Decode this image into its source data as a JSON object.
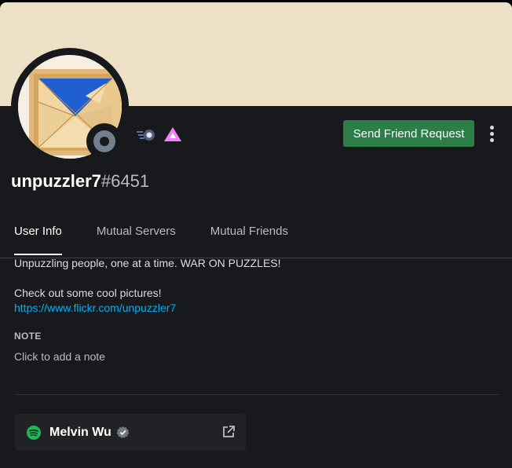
{
  "profile": {
    "username": "unpuzzler7",
    "discriminator": "#6451",
    "status": "offline",
    "banner_color": "#ede0c7",
    "badges": [
      "hypesquad-balance-icon",
      "early-supporter-icon"
    ]
  },
  "actions": {
    "friend_request_label": "Send Friend Request",
    "friend_request_color": "#2d7d46"
  },
  "tabs": [
    {
      "label": "User Info",
      "active": true
    },
    {
      "label": "Mutual Servers",
      "active": false
    },
    {
      "label": "Mutual Friends",
      "active": false
    }
  ],
  "user_info": {
    "bio_line1": "Unpuzzling people, one at a time. WAR ON PUZZLES!",
    "bio_line2": "Check out some cool pictures!",
    "bio_link": "https://www.flickr.com/unpuzzler7",
    "note_title": "NOTE",
    "note_placeholder": "Click to add a note"
  },
  "connections": [
    {
      "service": "spotify",
      "name": "Melvin Wu",
      "verified": true
    }
  ]
}
